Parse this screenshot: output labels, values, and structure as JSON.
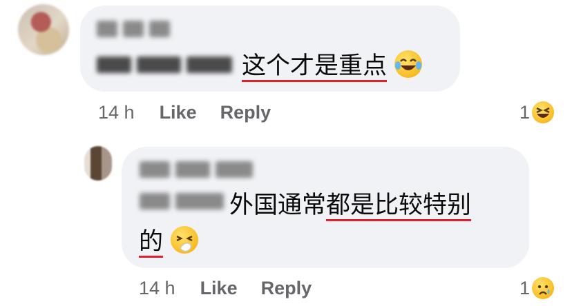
{
  "comments": [
    {
      "text_part1": "这个才是重点",
      "emoji": "laughing-crying-emoji",
      "timestamp": "14 h",
      "like_label": "Like",
      "reply_label": "Reply",
      "reaction_count": "1",
      "reaction_emoji": "laughing-emoji"
    },
    {
      "text_line1_plain": "外国通常",
      "text_line1_underlined": "都是比较特别",
      "text_line2": "的",
      "emoji": "sneezing-face-emoji",
      "timestamp": "14 h",
      "like_label": "Like",
      "reply_label": "Reply",
      "reaction_count": "1",
      "reaction_emoji": "crying-emoji"
    }
  ]
}
